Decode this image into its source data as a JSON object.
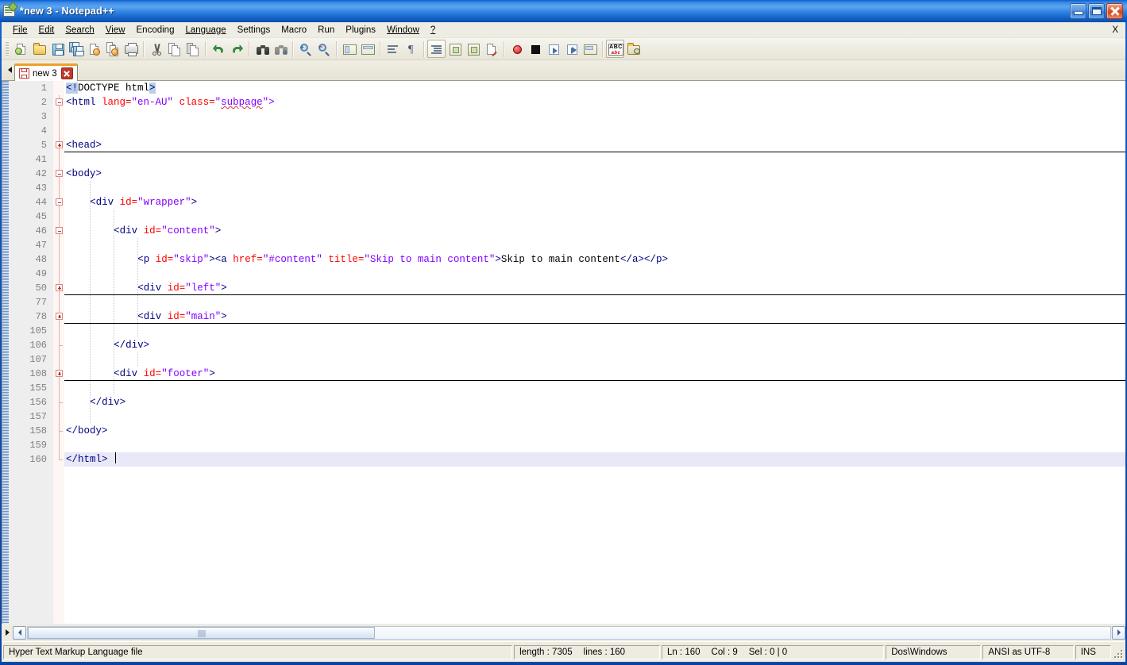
{
  "window": {
    "title": "*new  3 - Notepad++",
    "icon": "notepad-plus-plus-logo",
    "controls": {
      "minimize": "Minimize",
      "maximize": "Maximize",
      "close": "Close"
    }
  },
  "menu": {
    "items": [
      {
        "label": "File",
        "accel": "F"
      },
      {
        "label": "Edit",
        "accel": "E"
      },
      {
        "label": "Search",
        "accel": "S"
      },
      {
        "label": "View",
        "accel": "V"
      },
      {
        "label": "Encoding",
        "accel": ""
      },
      {
        "label": "Language",
        "accel": "L"
      },
      {
        "label": "Settings",
        "accel": "t"
      },
      {
        "label": "Macro",
        "accel": ""
      },
      {
        "label": "Run",
        "accel": ""
      },
      {
        "label": "Plugins",
        "accel": ""
      },
      {
        "label": "Window",
        "accel": "W"
      },
      {
        "label": "?",
        "accel": "?"
      }
    ],
    "document_close_label": "X"
  },
  "toolbar": {
    "buttons": [
      {
        "name": "new-file",
        "tooltip": "New"
      },
      {
        "name": "open-file",
        "tooltip": "Open"
      },
      {
        "name": "save-file",
        "tooltip": "Save"
      },
      {
        "name": "save-all",
        "tooltip": "Save All"
      },
      {
        "name": "close-file",
        "tooltip": "Close"
      },
      {
        "name": "close-all",
        "tooltip": "Close All"
      },
      {
        "name": "print",
        "tooltip": "Print"
      },
      {
        "name": "cut",
        "tooltip": "Cut"
      },
      {
        "name": "copy",
        "tooltip": "Copy"
      },
      {
        "name": "paste",
        "tooltip": "Paste"
      },
      {
        "name": "undo",
        "tooltip": "Undo"
      },
      {
        "name": "redo",
        "tooltip": "Redo"
      },
      {
        "name": "find",
        "tooltip": "Find"
      },
      {
        "name": "replace",
        "tooltip": "Replace"
      },
      {
        "name": "zoom-in",
        "tooltip": "Zoom In"
      },
      {
        "name": "zoom-out",
        "tooltip": "Zoom Out"
      },
      {
        "name": "sync-vertical-scroll",
        "tooltip": "Synchronize Vertical Scrolling"
      },
      {
        "name": "sync-horizontal-scroll",
        "tooltip": "Synchronize Horizontal Scrolling"
      },
      {
        "name": "word-wrap",
        "tooltip": "Word wrap"
      },
      {
        "name": "show-all-characters",
        "tooltip": "Show All Characters"
      },
      {
        "name": "show-indent-guide",
        "tooltip": "Show Indent Guide"
      },
      {
        "name": "user-defined-dialog",
        "tooltip": "User Defined Dialogue"
      },
      {
        "name": "document-map",
        "tooltip": "Document Map"
      },
      {
        "name": "function-list",
        "tooltip": "Function List"
      },
      {
        "name": "record-macro",
        "tooltip": "Start Recording"
      },
      {
        "name": "stop-macro",
        "tooltip": "Stop Recording"
      },
      {
        "name": "play-macro",
        "tooltip": "Playback"
      },
      {
        "name": "run-macro-multiple",
        "tooltip": "Run a Macro Multiple Times"
      },
      {
        "name": "save-macro",
        "tooltip": "Save Current Recorded Macro"
      },
      {
        "name": "spell-check",
        "tooltip": "Spell Checker"
      },
      {
        "name": "run",
        "tooltip": "Run"
      }
    ]
  },
  "tabs": {
    "scroll_left": "scroll tabs left",
    "items": [
      {
        "label": "new  3",
        "modified": true,
        "active": true,
        "close": "close tab"
      }
    ]
  },
  "editor": {
    "lines": [
      {
        "num": "1",
        "indent": 0,
        "fold": "none",
        "guides": 0,
        "current": false,
        "tokens": [
          {
            "t": "<!",
            "c": "sel"
          },
          {
            "t": "DOCTYPE html",
            "c": "df"
          },
          {
            "t": ">",
            "c": "sel"
          }
        ]
      },
      {
        "num": "2",
        "indent": 0,
        "fold": "open",
        "guides": 0,
        "current": false,
        "tokens": [
          {
            "t": "<html ",
            "c": "tg"
          },
          {
            "t": "lang=",
            "c": "at"
          },
          {
            "t": "\"en-AU\"",
            "c": "vl"
          },
          {
            "t": " ",
            "c": "df"
          },
          {
            "t": "class=",
            "c": "at"
          },
          {
            "t": "\"",
            "c": "vl"
          },
          {
            "t": "subpage",
            "c": "vl squig"
          },
          {
            "t": "\">",
            "c": "vl"
          }
        ]
      },
      {
        "num": "3",
        "indent": 0,
        "fold": "line",
        "guides": 0,
        "current": false,
        "tokens": []
      },
      {
        "num": "4",
        "indent": 0,
        "fold": "line",
        "guides": 0,
        "current": false,
        "tokens": []
      },
      {
        "num": "5",
        "indent": 0,
        "fold": "collapsed",
        "guides": 0,
        "current": false,
        "tokens": [
          {
            "t": "<head>",
            "c": "tg"
          }
        ]
      },
      {
        "num": "41",
        "indent": 0,
        "fold": "line",
        "guides": 0,
        "current": false,
        "tokens": []
      },
      {
        "num": "42",
        "indent": 0,
        "fold": "open",
        "guides": 0,
        "current": false,
        "tokens": [
          {
            "t": "<body>",
            "c": "tg"
          }
        ]
      },
      {
        "num": "43",
        "indent": 0,
        "fold": "line",
        "guides": 1,
        "current": false,
        "tokens": []
      },
      {
        "num": "44",
        "indent": 1,
        "fold": "open",
        "guides": 1,
        "current": false,
        "tokens": [
          {
            "t": "<div ",
            "c": "tg"
          },
          {
            "t": "id=",
            "c": "at"
          },
          {
            "t": "\"wrapper\"",
            "c": "vl"
          },
          {
            "t": ">",
            "c": "tg"
          }
        ]
      },
      {
        "num": "45",
        "indent": 0,
        "fold": "line",
        "guides": 2,
        "current": false,
        "tokens": []
      },
      {
        "num": "46",
        "indent": 2,
        "fold": "open",
        "guides": 2,
        "current": false,
        "tokens": [
          {
            "t": "<div ",
            "c": "tg"
          },
          {
            "t": "id=",
            "c": "at"
          },
          {
            "t": "\"content\"",
            "c": "vl"
          },
          {
            "t": ">",
            "c": "tg"
          }
        ]
      },
      {
        "num": "47",
        "indent": 0,
        "fold": "line",
        "guides": 3,
        "current": false,
        "tokens": []
      },
      {
        "num": "48",
        "indent": 3,
        "fold": "line",
        "guides": 3,
        "current": false,
        "tokens": [
          {
            "t": "<p ",
            "c": "tg"
          },
          {
            "t": "id=",
            "c": "at"
          },
          {
            "t": "\"skip\"",
            "c": "vl"
          },
          {
            "t": "><a ",
            "c": "tg"
          },
          {
            "t": "href=",
            "c": "at"
          },
          {
            "t": "\"#content\"",
            "c": "vl"
          },
          {
            "t": " ",
            "c": "df"
          },
          {
            "t": "title=",
            "c": "at"
          },
          {
            "t": "\"Skip to main content\"",
            "c": "vl"
          },
          {
            "t": ">",
            "c": "tg"
          },
          {
            "t": "Skip to main content",
            "c": "df"
          },
          {
            "t": "</a></p>",
            "c": "tg"
          }
        ]
      },
      {
        "num": "49",
        "indent": 0,
        "fold": "line",
        "guides": 3,
        "current": false,
        "tokens": []
      },
      {
        "num": "50",
        "indent": 3,
        "fold": "collapsed",
        "guides": 3,
        "current": false,
        "tokens": [
          {
            "t": "<div ",
            "c": "tg"
          },
          {
            "t": "id=",
            "c": "at"
          },
          {
            "t": "\"left\"",
            "c": "vl"
          },
          {
            "t": ">",
            "c": "tg"
          }
        ]
      },
      {
        "num": "77",
        "indent": 0,
        "fold": "line",
        "guides": 3,
        "current": false,
        "tokens": []
      },
      {
        "num": "78",
        "indent": 3,
        "fold": "collapsed",
        "guides": 3,
        "current": false,
        "tokens": [
          {
            "t": "<div ",
            "c": "tg"
          },
          {
            "t": "id=",
            "c": "at"
          },
          {
            "t": "\"main\"",
            "c": "vl"
          },
          {
            "t": ">",
            "c": "tg"
          }
        ]
      },
      {
        "num": "105",
        "indent": 0,
        "fold": "line",
        "guides": 3,
        "current": false,
        "tokens": []
      },
      {
        "num": "106",
        "indent": 2,
        "fold": "tick",
        "guides": 2,
        "current": false,
        "tokens": [
          {
            "t": "</div>",
            "c": "tg"
          }
        ]
      },
      {
        "num": "107",
        "indent": 0,
        "fold": "line",
        "guides": 3,
        "current": false,
        "tokens": []
      },
      {
        "num": "108",
        "indent": 2,
        "fold": "collapsed",
        "guides": 2,
        "current": false,
        "tokens": [
          {
            "t": "<div ",
            "c": "tg"
          },
          {
            "t": "id=",
            "c": "at"
          },
          {
            "t": "\"footer\"",
            "c": "vl"
          },
          {
            "t": ">",
            "c": "tg"
          }
        ]
      },
      {
        "num": "155",
        "indent": 0,
        "fold": "line",
        "guides": 2,
        "current": false,
        "tokens": []
      },
      {
        "num": "156",
        "indent": 1,
        "fold": "tick",
        "guides": 1,
        "current": false,
        "tokens": [
          {
            "t": "</div>",
            "c": "tg"
          }
        ]
      },
      {
        "num": "157",
        "indent": 0,
        "fold": "line",
        "guides": 1,
        "current": false,
        "tokens": []
      },
      {
        "num": "158",
        "indent": 0,
        "fold": "tick",
        "guides": 0,
        "current": false,
        "tokens": [
          {
            "t": "</body>",
            "c": "tg"
          }
        ]
      },
      {
        "num": "159",
        "indent": 0,
        "fold": "line",
        "guides": 0,
        "current": false,
        "tokens": []
      },
      {
        "num": "160",
        "indent": 0,
        "fold": "end",
        "guides": 0,
        "current": true,
        "caret": true,
        "tokens": [
          {
            "t": "</html>",
            "c": "tg"
          }
        ]
      }
    ]
  },
  "scrollbar": {
    "left_arrow": "◀",
    "right_arrow": "▶",
    "dock_arrow": "▶"
  },
  "statusbar": {
    "language": "Hyper Text Markup Language file",
    "length_label": "length : 7305",
    "lines_label": "lines : 160",
    "ln": "Ln : 160",
    "col": "Col : 9",
    "sel": "Sel : 0 | 0",
    "eol": "Dos\\Windows",
    "encoding": "ANSI as UTF-8",
    "insert_mode": "INS"
  },
  "colors": {
    "titlebar": "#3b8ae8",
    "tag": "#000080",
    "attribute": "#ff0000",
    "value": "#8000ff",
    "selection": "#b8d0ea",
    "current_line": "#e8e8f8",
    "fold_box": "#c0392b",
    "tab_active_top": "#f0a028"
  }
}
